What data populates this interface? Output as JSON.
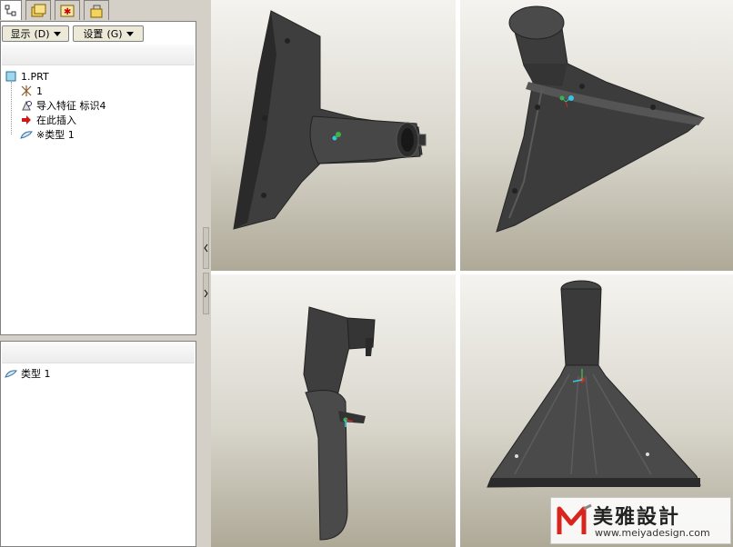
{
  "toolbar": {
    "show_label": "显示",
    "show_hotkey": "(D)",
    "settings_label": "设置",
    "settings_hotkey": "(G)"
  },
  "model_tree": {
    "root": "1.PRT",
    "items": [
      {
        "label": "1",
        "icon": "csys-icon"
      },
      {
        "label": "导入特征 标识4",
        "icon": "import-feature-icon"
      },
      {
        "label": "在此插入",
        "icon": "insert-arrow-icon"
      },
      {
        "label": "※类型 1",
        "icon": "quilt-icon"
      }
    ]
  },
  "layer_tree": {
    "items": [
      {
        "label": "类型 1",
        "icon": "quilt-icon"
      }
    ]
  },
  "watermark": {
    "brand_cn": "美雅設計",
    "url": "www.meiyadesign.com",
    "mark": "M"
  },
  "colors": {
    "model": "#3c3c3c",
    "viewport_top": "#f4f3ef",
    "viewport_bottom": "#aea997",
    "watermark_red": "#d8261f"
  }
}
